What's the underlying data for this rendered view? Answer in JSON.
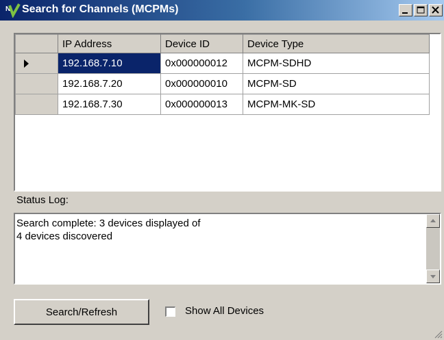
{
  "window": {
    "title": "Search for Channels (MCPMs)",
    "logo_icon": "nv-logo-icon",
    "controls": [
      "minimize-icon",
      "maximize-icon",
      "close-icon"
    ]
  },
  "grid": {
    "columns": [
      "IP Address",
      "Device ID",
      "Device Type"
    ],
    "rows": [
      {
        "ip": "192.168.7.10",
        "id": "0x000000012",
        "type": "MCPM-SDHD",
        "current": true
      },
      {
        "ip": "192.168.7.20",
        "id": "0x000000010",
        "type": "MCPM-SD",
        "current": false
      },
      {
        "ip": "192.168.7.30",
        "id": "0x000000013",
        "type": "MCPM-MK-SD",
        "current": false
      }
    ],
    "selected_cell_color": "#0a246a"
  },
  "status_log": {
    "label": "Status Log:",
    "text": "Search complete: 3 devices displayed of\n4 devices discovered"
  },
  "controls": {
    "search_button": "Search/Refresh",
    "show_all_label": "Show All Devices",
    "show_all_checked": false
  }
}
